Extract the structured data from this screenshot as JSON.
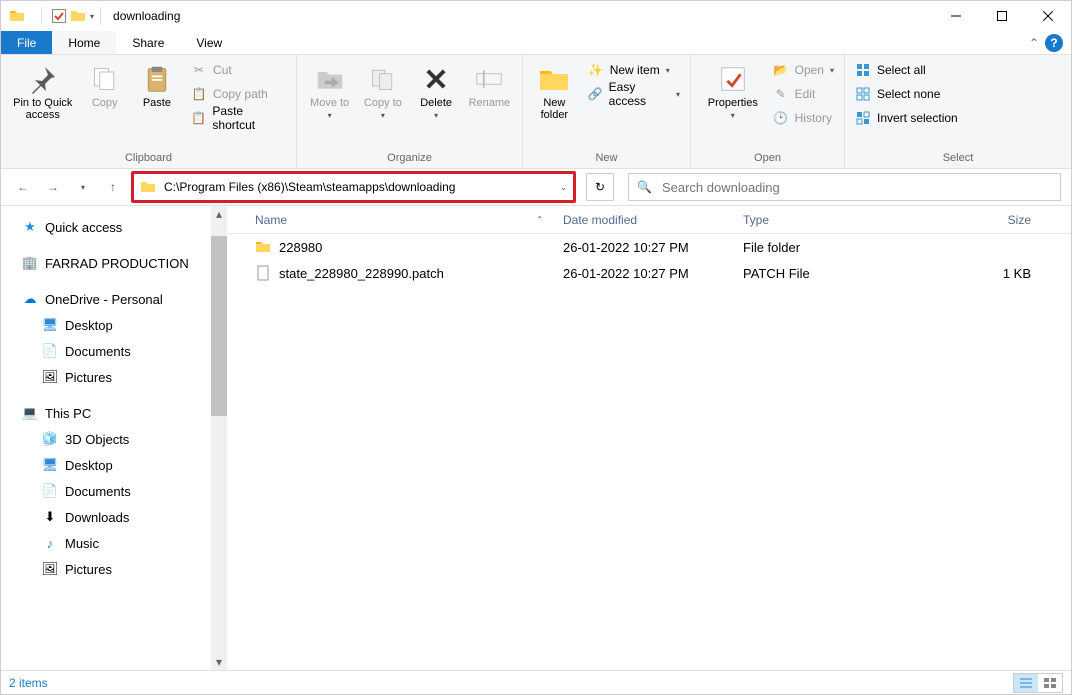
{
  "window": {
    "title": "downloading"
  },
  "tabs": {
    "file": "File",
    "home": "Home",
    "share": "Share",
    "view": "View"
  },
  "ribbon": {
    "clipboard": {
      "label": "Clipboard",
      "pin": "Pin to Quick access",
      "copy": "Copy",
      "paste": "Paste",
      "cut": "Cut",
      "copypath": "Copy path",
      "pasteshortcut": "Paste shortcut"
    },
    "organize": {
      "label": "Organize",
      "moveto": "Move to",
      "copyto": "Copy to",
      "delete": "Delete",
      "rename": "Rename"
    },
    "new": {
      "label": "New",
      "newfolder": "New folder",
      "newitem": "New item",
      "easyaccess": "Easy access"
    },
    "open": {
      "label": "Open",
      "properties": "Properties",
      "open": "Open",
      "edit": "Edit",
      "history": "History"
    },
    "select": {
      "label": "Select",
      "selectall": "Select all",
      "selectnone": "Select none",
      "invert": "Invert selection"
    }
  },
  "address": {
    "path": "C:\\Program Files (x86)\\Steam\\steamapps\\downloading"
  },
  "search": {
    "placeholder": "Search downloading"
  },
  "sidebar": {
    "quickaccess": "Quick access",
    "farrad": "FARRAD PRODUCTION",
    "onedrive": "OneDrive - Personal",
    "od_desktop": "Desktop",
    "od_documents": "Documents",
    "od_pictures": "Pictures",
    "thispc": "This PC",
    "pc_3d": "3D Objects",
    "pc_desktop": "Desktop",
    "pc_documents": "Documents",
    "pc_downloads": "Downloads",
    "pc_music": "Music",
    "pc_pictures": "Pictures"
  },
  "columns": {
    "name": "Name",
    "date": "Date modified",
    "type": "Type",
    "size": "Size"
  },
  "files": [
    {
      "name": "228980",
      "date": "26-01-2022 10:27 PM",
      "type": "File folder",
      "size": "",
      "icon": "folder"
    },
    {
      "name": "state_228980_228990.patch",
      "date": "26-01-2022 10:27 PM",
      "type": "PATCH File",
      "size": "1 KB",
      "icon": "file"
    }
  ],
  "status": {
    "items": "2 items"
  }
}
